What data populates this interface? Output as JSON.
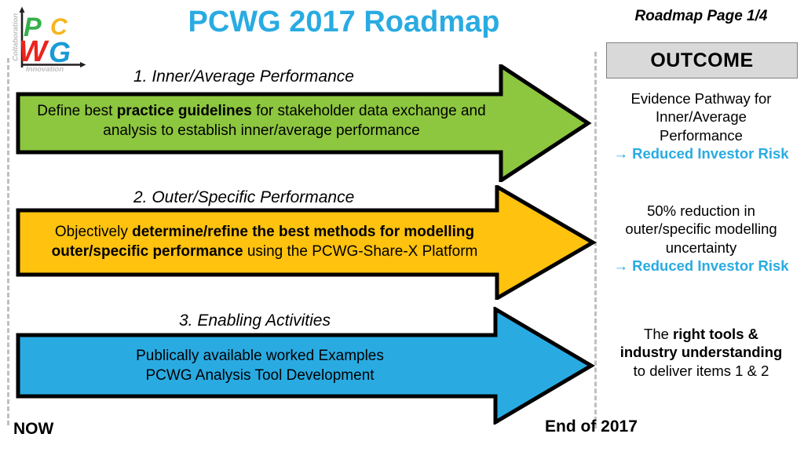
{
  "document": {
    "title": "PCWG 2017 Roadmap",
    "page_indicator": "Roadmap Page 1/4"
  },
  "logo": {
    "name": "pcwg-logo",
    "letters": [
      {
        "char": "P",
        "color": "#35B14A"
      },
      {
        "char": "C",
        "color": "#F7B51C"
      },
      {
        "char": "W",
        "color": "#E8251E"
      },
      {
        "char": "G",
        "color": "#1B9AD8"
      }
    ],
    "y_axis_label": "Collaboration",
    "x_axis_label": "Innovation",
    "axis_color": "#231F20",
    "axis_label_color": "#BFBFBF"
  },
  "timeline": {
    "start_label": "NOW",
    "end_label": "End of 2017",
    "rule_color": "#bfbfbf"
  },
  "outcome_header": {
    "label": "OUTCOME",
    "background": "#d9d9d9",
    "border": "#7f7f7f"
  },
  "accent_color": "#29ABE2",
  "steps": [
    {
      "number": 1,
      "caption": "1. Inner/Average Performance",
      "color": "#8DC63F",
      "body_segments": [
        {
          "text": "Define best ",
          "bold": false
        },
        {
          "text": "practice guidelines",
          "bold": true
        },
        {
          "text": " for stakeholder data exchange and analysis to establish inner/average performance",
          "bold": false
        }
      ],
      "body_text": "Define best practice guidelines for stakeholder data exchange and analysis to establish inner/average performance"
    },
    {
      "number": 2,
      "caption": "2. Outer/Specific Performance",
      "color": "#FFC20E",
      "body_segments": [
        {
          "text": "Objectively ",
          "bold": false
        },
        {
          "text": "determine/refine the best methods for modelling outer/specific performance",
          "bold": true
        },
        {
          "text": " using the PCWG-Share-X Platform",
          "bold": false
        }
      ],
      "body_text": "Objectively determine/refine the best methods for modelling outer/specific performance using the PCWG-Share-X Platform"
    },
    {
      "number": 3,
      "caption": "3. Enabling Activities",
      "color": "#29ABE2",
      "body_line_1": "Publically available worked Examples",
      "body_line_2": "PCWG Analysis Tool Development"
    }
  ],
  "outcomes": [
    {
      "for_step": 1,
      "line_1": "Evidence Pathway for",
      "line_2": "Inner/Average",
      "line_3": "Performance",
      "result_arrow": "→",
      "result": "Reduced Investor Risk"
    },
    {
      "for_step": 2,
      "line_1": "50% reduction in",
      "line_2": "outer/specific modelling",
      "line_3": "uncertainty",
      "result_arrow": "→",
      "result": "Reduced Investor Risk"
    },
    {
      "for_step": 3,
      "segments": [
        {
          "text": "The ",
          "bold": false
        },
        {
          "text": "right tools & industry understanding",
          "bold": true
        },
        {
          "text": " to deliver items 1 & 2",
          "bold": false
        }
      ],
      "line_1_plain": "The ",
      "line_1_bold": "right tools &",
      "line_2_bold": "industry understanding",
      "line_3_plain": "to deliver items 1 & 2"
    }
  ]
}
